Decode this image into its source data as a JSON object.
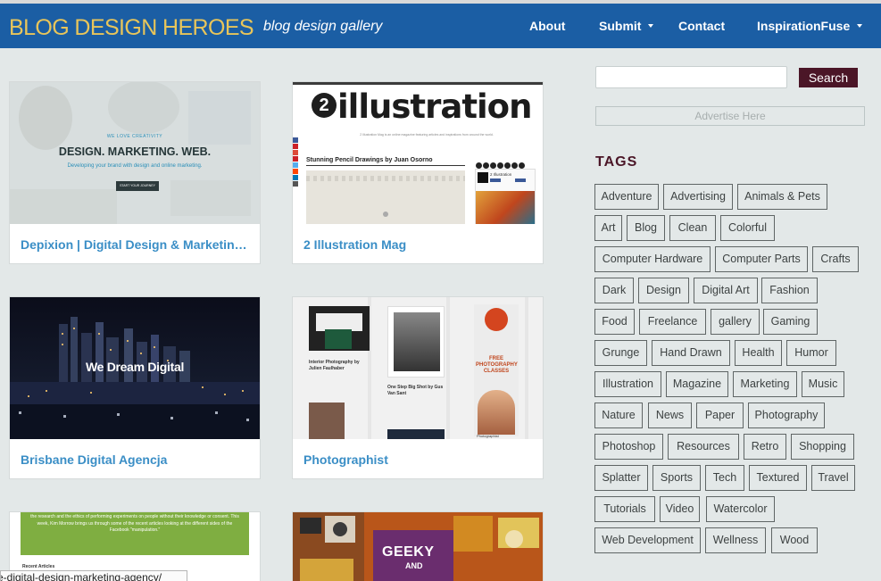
{
  "header": {
    "logo": "BLOG DESIGN HEROES",
    "tagline": "blog design gallery",
    "nav": [
      {
        "label": "About",
        "dropdown": false
      },
      {
        "label": "Submit",
        "dropdown": true
      },
      {
        "label": "Contact",
        "dropdown": false
      },
      {
        "label": "InspirationFuse",
        "dropdown": true
      }
    ]
  },
  "posts": [
    {
      "title": "Depixion | Digital Design & Marketing Agency",
      "thumb": {
        "kicker": "WE LOVE CREATIVITY",
        "headline": "DESIGN. MARKETING. WEB.",
        "sub": "Developing your brand with design and online marketing.",
        "button": "START YOUR JOURNEY"
      }
    },
    {
      "title": "2 Illustration Mag",
      "thumb": {
        "brand": "illustration",
        "badge": "2",
        "desc": "2 Illustration Mag is an online magazine featuring articles and inspirations from around the world.",
        "article": "Stunning Pencil Drawings by Juan Osorno",
        "side_label": "2 Illustration"
      }
    },
    {
      "title": "Brisbane Digital Agencja",
      "thumb": {
        "headline": "We Dream Digital"
      }
    },
    {
      "title": "Photographist",
      "thumb": {
        "a1": "Interior Photography by Julien Faulhaber",
        "a2": "One Step Big Shot by Gus Van Sant",
        "ad": "FREE PHOTOGRAPHY CLASSES",
        "badge": "Photographist"
      }
    },
    {
      "title": "",
      "thumb": {
        "text": "the research and the ethics of performing experiments on people without their knowledge or consent. This week, Kim Morrow brings us through some of the recent articles looking at the different sides of the Facebook \"manipulation.\"",
        "label": "Recent Articles"
      }
    },
    {
      "title": "",
      "thumb": {
        "headline": "GEEKY",
        "sub": "AND"
      }
    }
  ],
  "sidebar": {
    "search_button": "Search",
    "advertise": "Advertise Here",
    "tags_heading": "TAGS",
    "tags": [
      "Adventure",
      "Advertising",
      "Animals & Pets",
      "Art",
      "Blog",
      "Clean",
      "Colorful",
      "Computer Hardware",
      "Computer Parts",
      "Crafts",
      "Dark",
      "Design",
      "Digital Art",
      "Fashion",
      "Food",
      "Freelance",
      "gallery",
      "Gaming",
      "Grunge",
      "Hand Drawn",
      "Health",
      "Humor",
      "Illustration",
      "Magazine",
      "Marketing",
      "Music",
      "Nature",
      "News",
      "Paper",
      "Photography",
      "Photoshop",
      "Resources",
      "Retro",
      "Shopping",
      "Splatter",
      "Sports",
      "Tech",
      "Textured",
      "Travel",
      "Tutorials",
      "Video",
      "Watercolor",
      "Web Development",
      "Wellness",
      "Wood"
    ]
  },
  "statusbar": {
    "url": "e-digital-design-marketing-agency/"
  },
  "colors": {
    "header_bg": "#1b5ea4",
    "logo": "#e8c55a",
    "link": "#3a8ec6",
    "accent": "#4b1627",
    "page_bg": "#e3e8e8"
  }
}
